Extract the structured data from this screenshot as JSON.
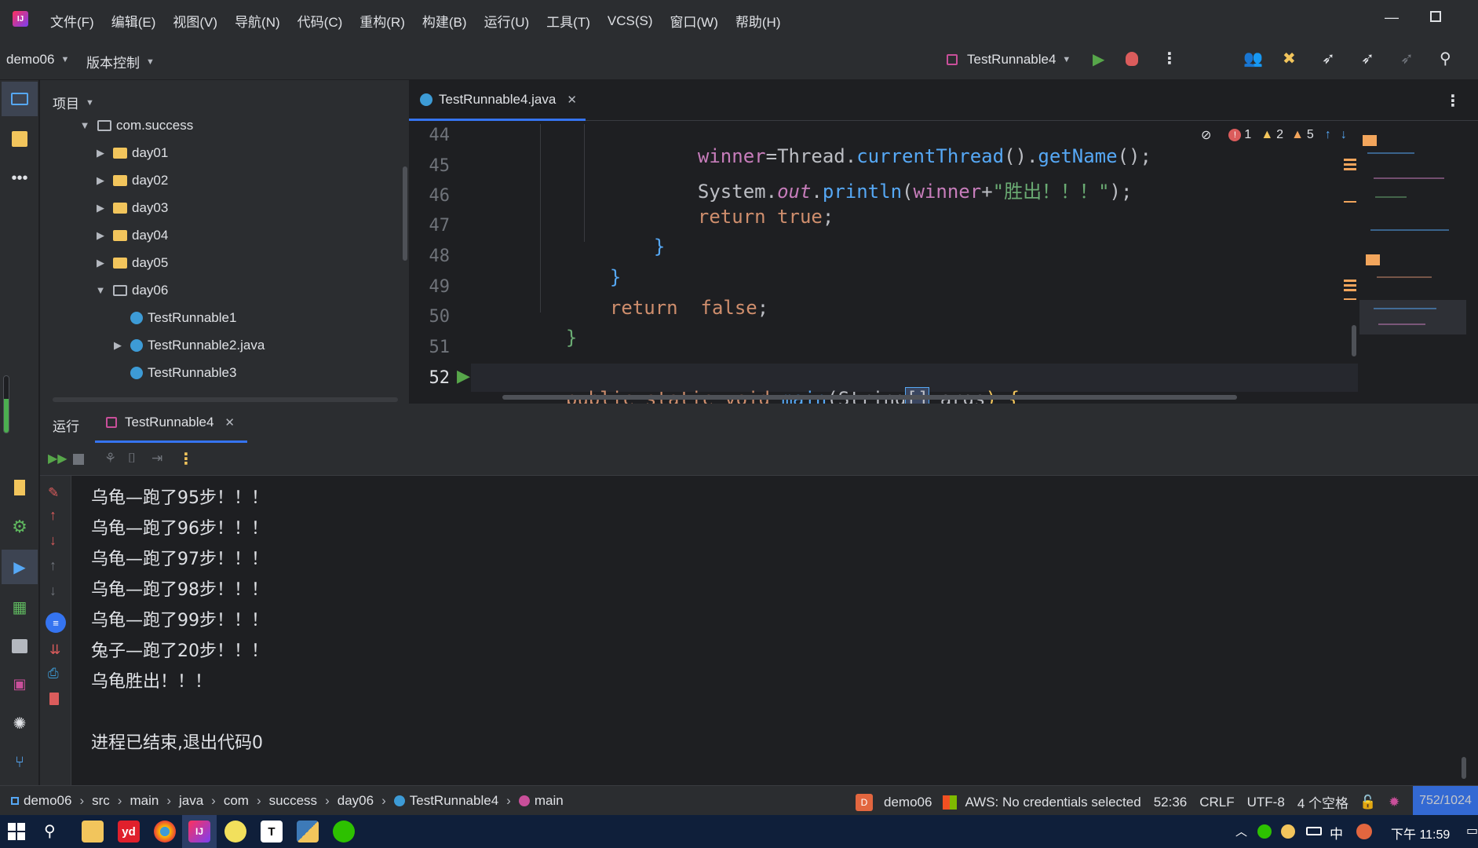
{
  "menu": [
    "文件(F)",
    "编辑(E)",
    "视图(V)",
    "导航(N)",
    "代码(C)",
    "重构(R)",
    "构建(B)",
    "运行(U)",
    "工具(T)",
    "VCS(S)",
    "窗口(W)",
    "帮助(H)"
  ],
  "toolbar": {
    "project": "demo06",
    "vcs": "版本控制",
    "run_config": "TestRunnable4"
  },
  "project_panel": {
    "title": "项目",
    "tree": [
      {
        "label": "com.success",
        "type": "package",
        "expanded": true
      },
      {
        "label": "day01",
        "type": "folder"
      },
      {
        "label": "day02",
        "type": "folder"
      },
      {
        "label": "day03",
        "type": "folder"
      },
      {
        "label": "day04",
        "type": "folder"
      },
      {
        "label": "day05",
        "type": "folder"
      },
      {
        "label": "day06",
        "type": "package",
        "expanded": true
      },
      {
        "label": "TestRunnable1",
        "type": "class"
      },
      {
        "label": "TestRunnable2.java",
        "type": "class"
      },
      {
        "label": "TestRunnable3",
        "type": "class"
      }
    ]
  },
  "editor": {
    "tab": "TestRunnable4.java",
    "inspections": {
      "errors": "1",
      "warnings": "2",
      "weak_warnings": "5"
    },
    "lines": [
      {
        "num": "44"
      },
      {
        "num": "45"
      },
      {
        "num": "46"
      },
      {
        "num": "47"
      },
      {
        "num": "48"
      },
      {
        "num": "49"
      },
      {
        "num": "50"
      },
      {
        "num": "51"
      },
      {
        "num": "52"
      }
    ],
    "code": {
      "l44_a": "winner",
      "l44_b": "=",
      "l44_c": "Thread",
      "l44_d": ".",
      "l44_e": "currentThread",
      "l44_f": "().",
      "l44_g": "getName",
      "l44_h": "();",
      "l45_a": "System",
      "l45_b": ".",
      "l45_c": "out",
      "l45_d": ".",
      "l45_e": "println",
      "l45_f": "(",
      "l45_g": "winner",
      "l45_h": "+",
      "l45_i": "\"胜出！！！\"",
      "l45_j": ");",
      "l46_a": "return",
      "l46_b": " true",
      "l46_c": ";",
      "l47": "}",
      "l48": "}",
      "l49_a": "return",
      "l49_b": "  false",
      "l49_c": ";",
      "l50": "}",
      "l52_a": "public static void",
      "l52_b": " main",
      "l52_c": "(",
      "l52_d": "String",
      "l52_e": "[]",
      "l52_f": " args",
      "l52_g": ") {"
    }
  },
  "run_panel": {
    "label": "运行",
    "tab": "TestRunnable4",
    "output": [
      "乌龟—跑了95步！！！",
      "乌龟—跑了96步！！！",
      "乌龟—跑了97步！！！",
      "乌龟—跑了98步！！！",
      "乌龟—跑了99步！！！",
      "兔子—跑了20步！！！",
      "乌龟胜出！！！",
      "",
      "进程已结束,退出代码0"
    ]
  },
  "statusbar": {
    "breadcrumbs": [
      "demo06",
      "src",
      "main",
      "java",
      "com",
      "success",
      "day06",
      "TestRunnable4",
      "main"
    ],
    "project": "demo06",
    "aws": "AWS: No credentials selected",
    "position": "52:36",
    "line_sep": "CRLF",
    "encoding": "UTF-8",
    "indent": "4 个空格",
    "memory": "752/1024"
  },
  "taskbar": {
    "ime": "中",
    "time": "下午 11:59"
  },
  "colors": {
    "keyword": "#cf8e6d",
    "field": "#c77dbb",
    "method": "#56a8f5",
    "string": "#6aab73",
    "accent": "#3574f0"
  }
}
